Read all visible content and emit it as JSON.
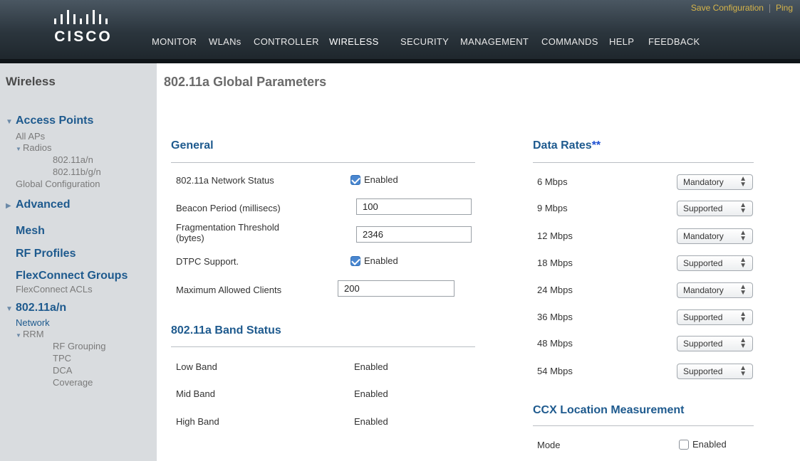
{
  "header": {
    "logo_text": "CISCO",
    "top_links": [
      "Save Configuration",
      "Ping"
    ],
    "nav": [
      "MONITOR",
      "WLANs",
      "CONTROLLER",
      "WIRELESS",
      "SECURITY",
      "MANAGEMENT",
      "COMMANDS",
      "HELP",
      "FEEDBACK"
    ],
    "active_nav": "WIRELESS"
  },
  "sidebar": {
    "title": "Wireless",
    "access_points": "Access Points",
    "all_aps": "All APs",
    "radios": "Radios",
    "radio_a": "802.11a/n",
    "radio_b": "802.11b/g/n",
    "global_config": "Global Configuration",
    "advanced": "Advanced",
    "mesh": "Mesh",
    "rf_profiles": "RF Profiles",
    "flexconnect_groups": "FlexConnect Groups",
    "flexconnect_acls": "FlexConnect ACLs",
    "section_80211an": "802.11a/n",
    "network": "Network",
    "rrm": "RRM",
    "rf_grouping": "RF Grouping",
    "tpc": "TPC",
    "dca": "DCA",
    "coverage": "Coverage"
  },
  "page": {
    "title": "802.11a Global Parameters"
  },
  "general": {
    "title": "General",
    "network_status_label": "802.11a Network Status",
    "network_status_value": "Enabled",
    "beacon_label": "Beacon Period (millisecs)",
    "beacon_value": "100",
    "frag_label_1": "Fragmentation Threshold",
    "frag_label_2": "(bytes)",
    "frag_value": "2346",
    "dtpc_label": "DTPC Support.",
    "dtpc_value": "Enabled",
    "max_clients_label": "Maximum Allowed Clients",
    "max_clients_value": "200"
  },
  "band_status": {
    "title": "802.11a Band Status",
    "rows": [
      {
        "label": "Low Band",
        "value": "Enabled"
      },
      {
        "label": "Mid Band",
        "value": "Enabled"
      },
      {
        "label": "High Band",
        "value": "Enabled"
      }
    ]
  },
  "data_rates": {
    "title": "Data Rates",
    "stars": "**",
    "rows": [
      {
        "rate": "6 Mbps",
        "setting": "Mandatory"
      },
      {
        "rate": "9 Mbps",
        "setting": "Supported"
      },
      {
        "rate": "12 Mbps",
        "setting": "Mandatory"
      },
      {
        "rate": "18 Mbps",
        "setting": "Supported"
      },
      {
        "rate": "24 Mbps",
        "setting": "Mandatory"
      },
      {
        "rate": "36 Mbps",
        "setting": "Supported"
      },
      {
        "rate": "48 Mbps",
        "setting": "Supported"
      },
      {
        "rate": "54 Mbps",
        "setting": "Supported"
      }
    ]
  },
  "ccx": {
    "title": "CCX Location Measurement",
    "mode_label": "Mode",
    "mode_value": "Enabled"
  },
  "colors": {
    "accent": "#f0a030",
    "section_blue": "#1e5a8e",
    "sidebar_bg": "#d9dcdf"
  }
}
